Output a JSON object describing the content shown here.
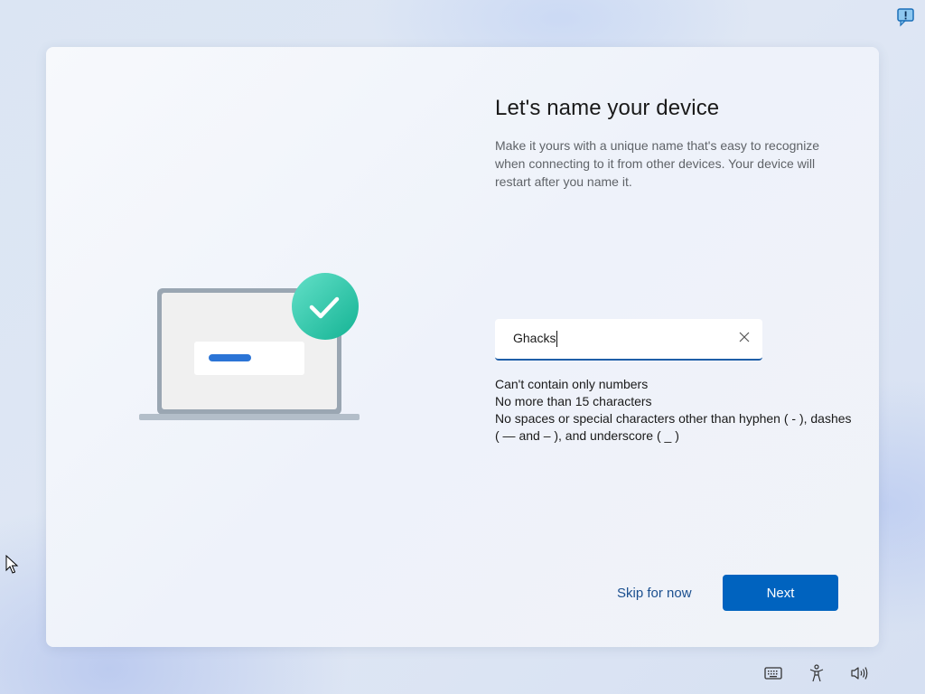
{
  "page": {
    "title": "Let's name your device",
    "description": "Make it yours with a unique name that's easy to recognize when connecting to it from other devices. Your device will restart after you name it."
  },
  "name_input": {
    "value": "Ghacks",
    "clear_icon": "close-icon"
  },
  "rules": [
    "Can't contain only numbers",
    "No more than 15 characters",
    "No spaces or special characters other than hyphen ( - ), dashes ( — and – ), and underscore ( _ )"
  ],
  "actions": {
    "skip_label": "Skip for now",
    "next_label": "Next"
  },
  "tray": {
    "icons": [
      "keyboard-icon",
      "accessibility-icon",
      "volume-icon"
    ]
  },
  "colors": {
    "accent": "#0063bf",
    "link": "#1b4f8f",
    "check_badge": "#2ec4a6"
  }
}
